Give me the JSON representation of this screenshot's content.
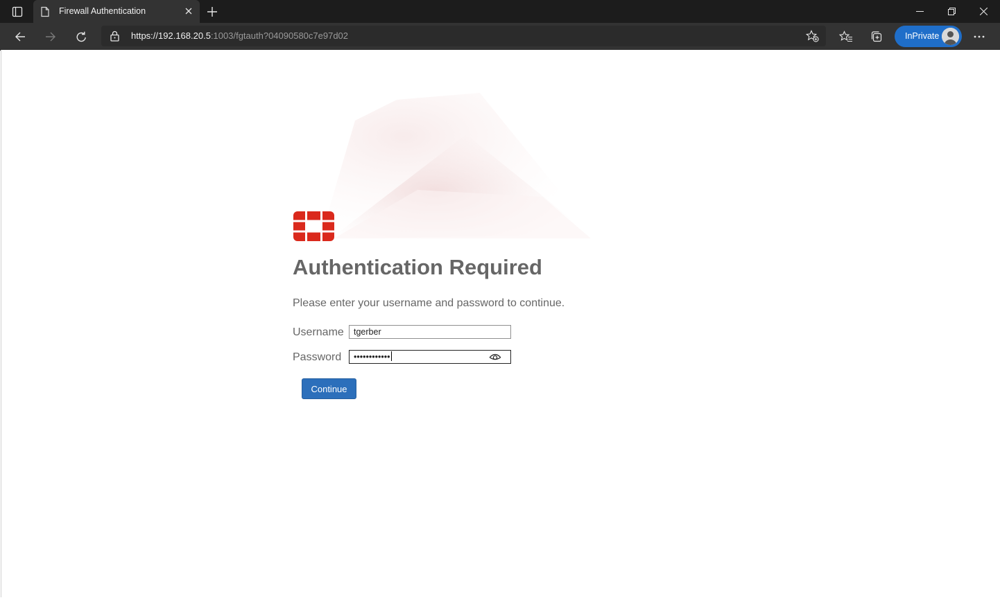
{
  "browser": {
    "tab": {
      "title": "Firewall Authentication"
    },
    "address": {
      "scheme_host": "https://192.168.20.5",
      "rest": ":1003/fgtauth?04090580c7e97d02"
    },
    "profile": {
      "label": "InPrivate"
    },
    "icons": {
      "tab_actions": "tab-actions-icon",
      "page": "page-icon",
      "close_tab": "close-icon",
      "new_tab": "plus-icon",
      "back": "back-arrow-icon",
      "forward": "forward-arrow-icon",
      "refresh": "refresh-icon",
      "lock": "lock-icon",
      "add_favorite": "star-add-icon",
      "favorites": "favorites-icon",
      "collections": "collections-icon",
      "more": "more-icon"
    }
  },
  "page": {
    "heading": "Authentication Required",
    "prompt": "Please enter your username and password to continue.",
    "username": {
      "label": "Username",
      "value": "tgerber"
    },
    "password": {
      "label": "Password",
      "value": "••••••••••••"
    },
    "continue_label": "Continue",
    "colors": {
      "logo_red": "#da291c",
      "button_blue": "#2c6fbb",
      "text_gray": "#666666"
    }
  }
}
